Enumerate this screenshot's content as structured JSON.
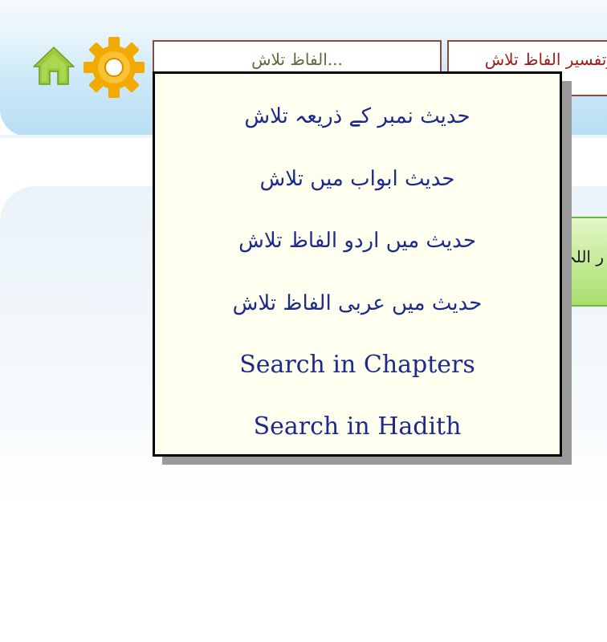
{
  "header": {
    "tabs": [
      {
        "label": "...الفاظ تلاش"
      },
      {
        "label": "وتفسیر الفاظ تلاش"
      }
    ]
  },
  "icons": {
    "home": "home-icon",
    "settings": "gear-icon"
  },
  "badge": {
    "text": "ر اللہ"
  },
  "dropdown": {
    "items": [
      {
        "label": "حدیث نمبر کے ذریعہ تلاش"
      },
      {
        "label": "حدیث ابواب میں تلاش"
      },
      {
        "label": "حدیث میں اردو الفاظ تلاش"
      },
      {
        "label": "حدیث میں عربی الفاظ تلاش"
      },
      {
        "label": "Search in Chapters"
      },
      {
        "label": "Search in Hadith"
      }
    ]
  },
  "colors": {
    "menu_text": "#1d2a8c",
    "menu_background": "#fffff0",
    "tab_border": "#8b4a3c",
    "home_icon": "#9acb3c",
    "gear_icon": "#f2a900",
    "header_gradient_end": "#b7def3",
    "badge_green": "#a9df6c"
  }
}
